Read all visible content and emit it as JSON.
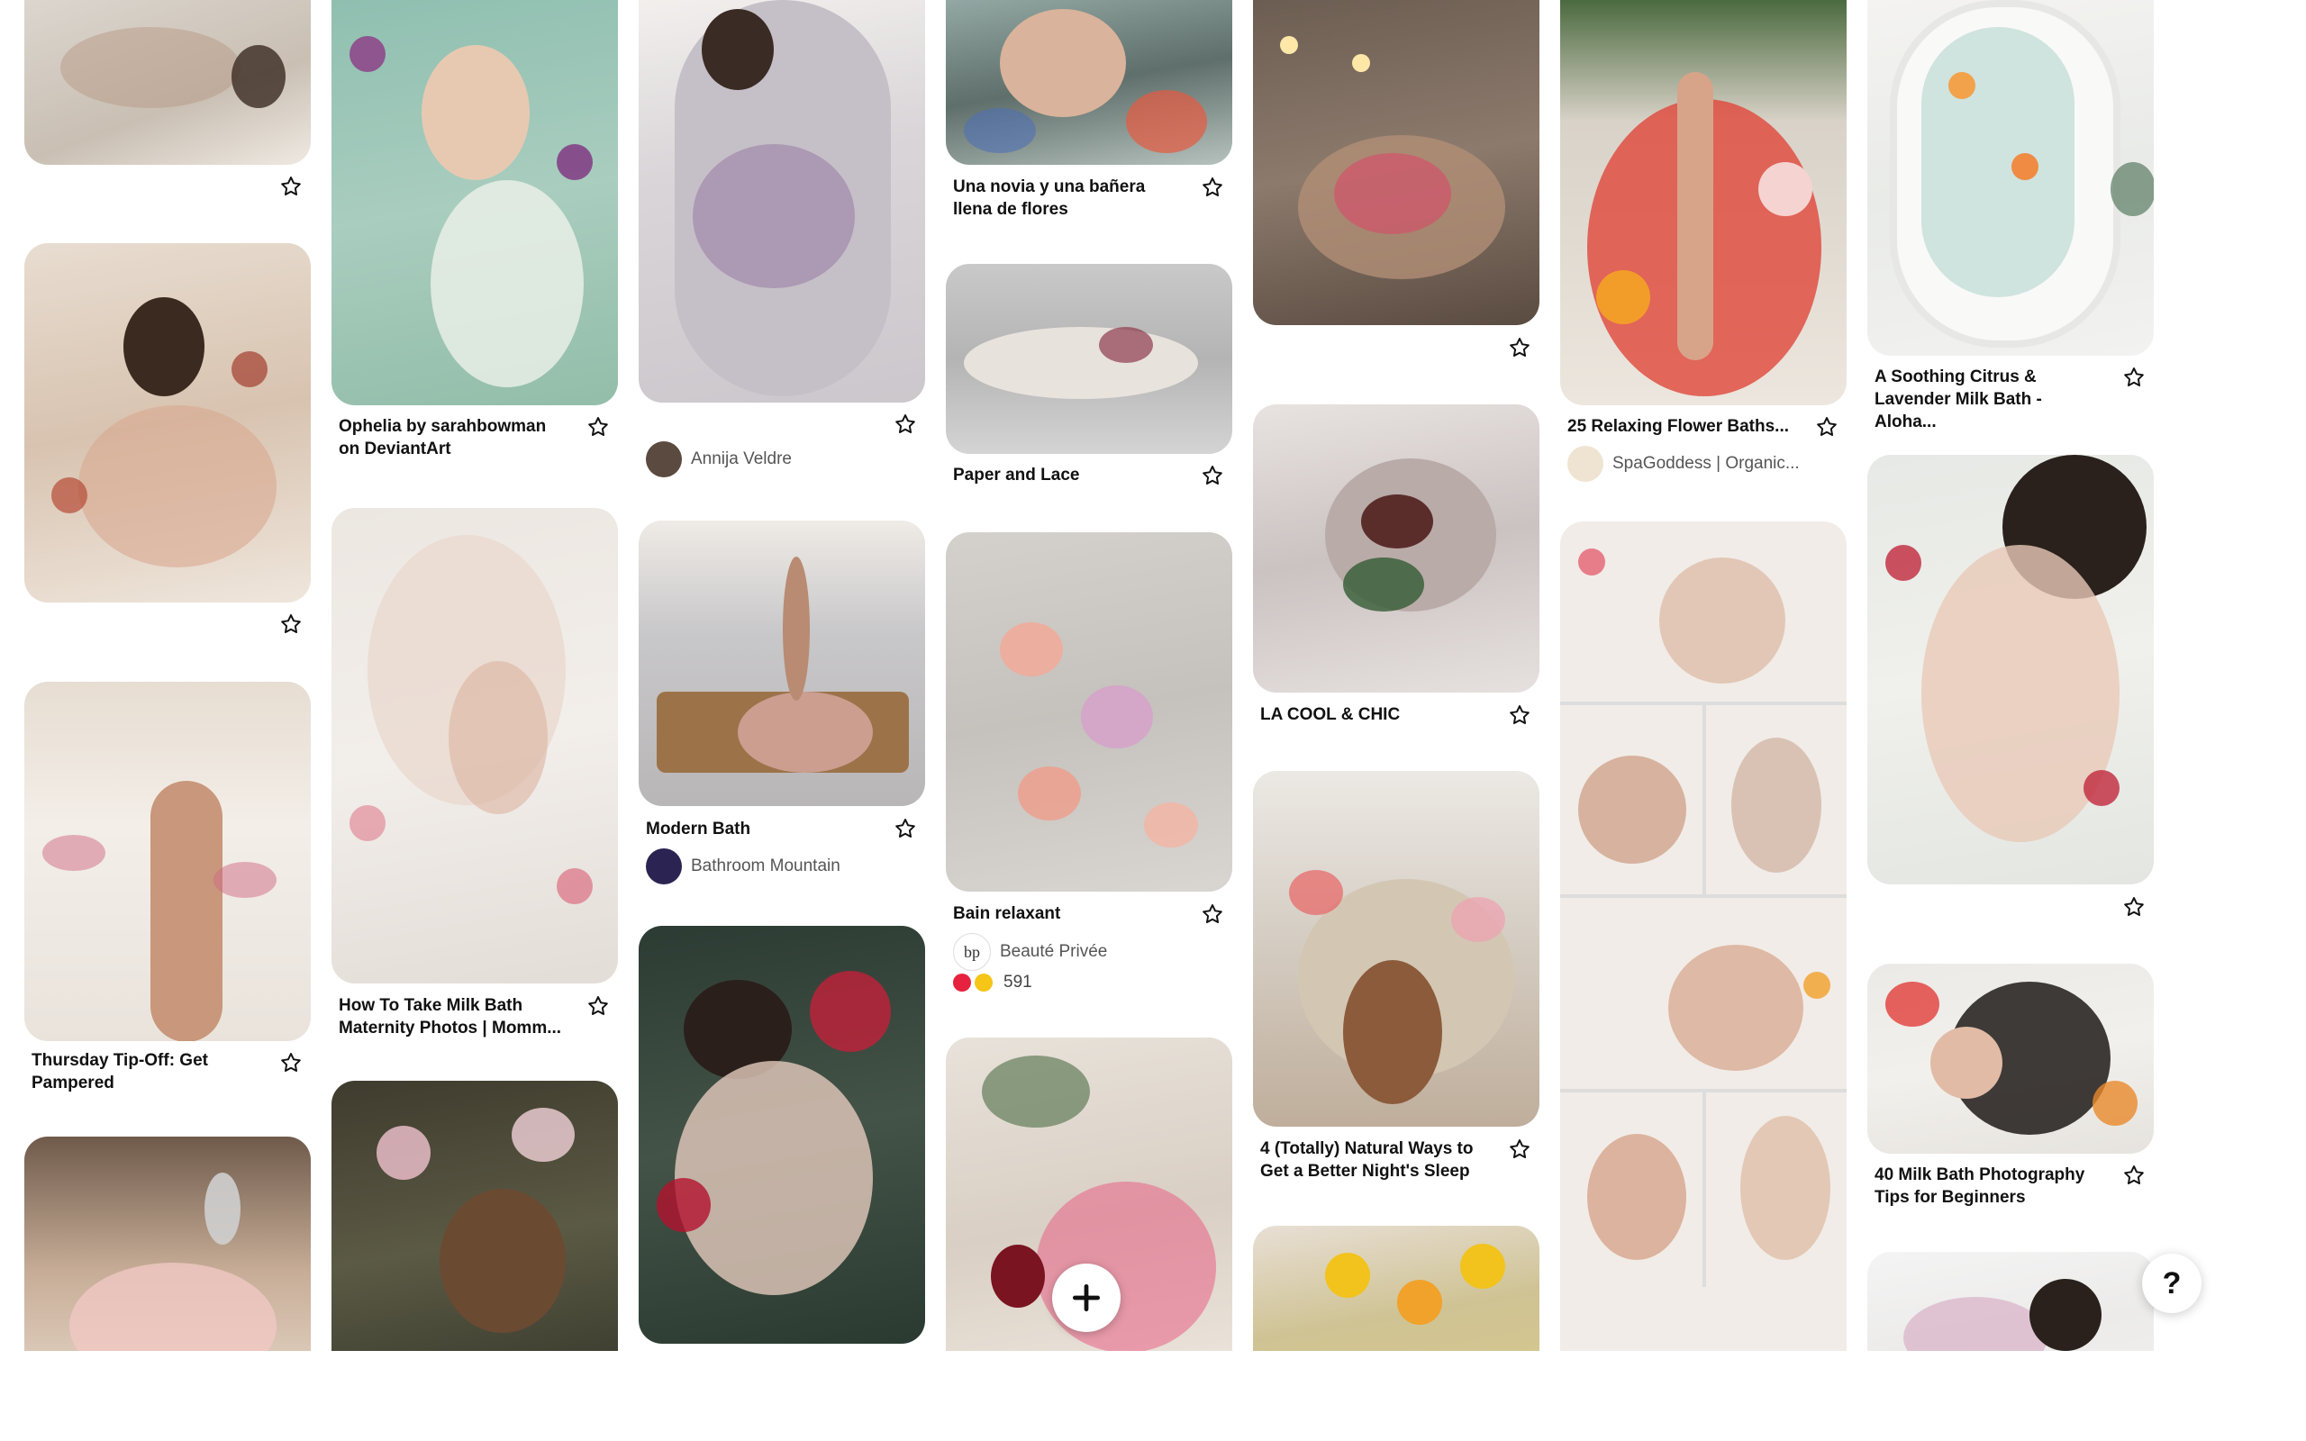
{
  "pins": {
    "c1p1": {
      "caption": ""
    },
    "c1p2": {
      "caption": ""
    },
    "c1p3": {
      "caption": "Thursday Tip-Off: Get Pampered"
    },
    "c2p1": {
      "caption": "Ophelia by sarahbowman on DeviantArt"
    },
    "c2p2": {
      "caption": "How To Take Milk Bath Maternity Photos | Momm..."
    },
    "c3p1": {
      "author": "Annija Veldre"
    },
    "c3p2": {
      "caption": "Modern Bath",
      "author": "Bathroom Mountain"
    },
    "c4p1": {
      "caption": "Una novia y una bañera llena de flores"
    },
    "c4p2": {
      "caption": "Paper and Lace"
    },
    "c4p3": {
      "caption": "Bain relaxant",
      "author": "Beauté Privée",
      "reactions": "591"
    },
    "c5p2": {
      "caption": "LA COOL & CHIC"
    },
    "c5p3": {
      "caption": "4 (Totally) Natural Ways to Get a Better Night's Sleep"
    },
    "c6p1": {
      "caption": "25 Relaxing Flower Baths...",
      "author": "SpaGoddess | Organic..."
    },
    "c7p1": {
      "caption": "A Soothing Citrus & Lavender Milk Bath - Aloha..."
    },
    "c7p3": {
      "caption": "40 Milk Bath Photography Tips for Beginners"
    }
  },
  "controls": {
    "add_icon": "plus-icon",
    "help_label": "?"
  },
  "icons": {
    "save": "star-outline-icon"
  },
  "colors": {
    "text": "#111111",
    "muted": "#555555",
    "background": "#ffffff"
  }
}
